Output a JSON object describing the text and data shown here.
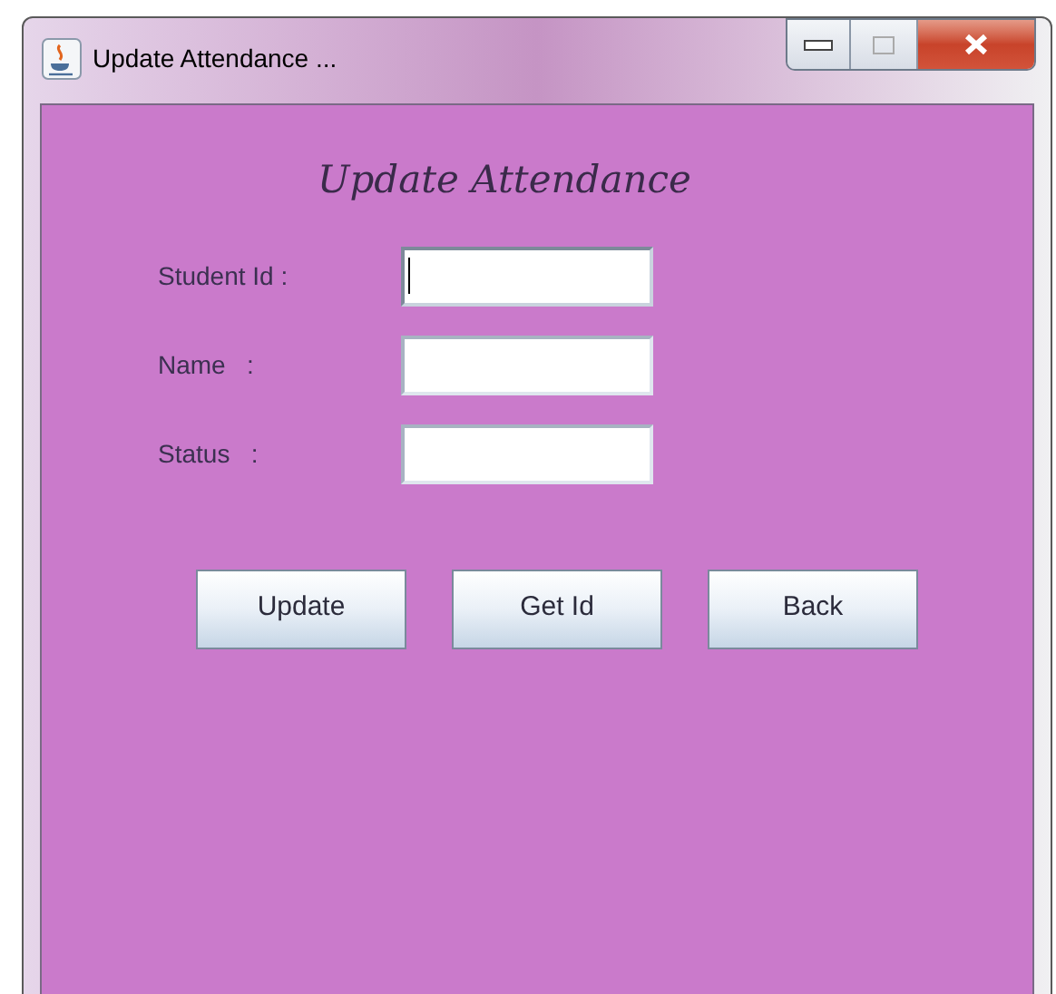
{
  "window": {
    "title": "Update Attendance ..."
  },
  "heading": "Update Attendance",
  "fields": [
    {
      "label": "Student Id :",
      "focused": true
    },
    {
      "label": "Name   :",
      "focused": false
    },
    {
      "label": "Status   :",
      "focused": false
    }
  ],
  "buttons": [
    "Update",
    "Get Id",
    "Back"
  ]
}
